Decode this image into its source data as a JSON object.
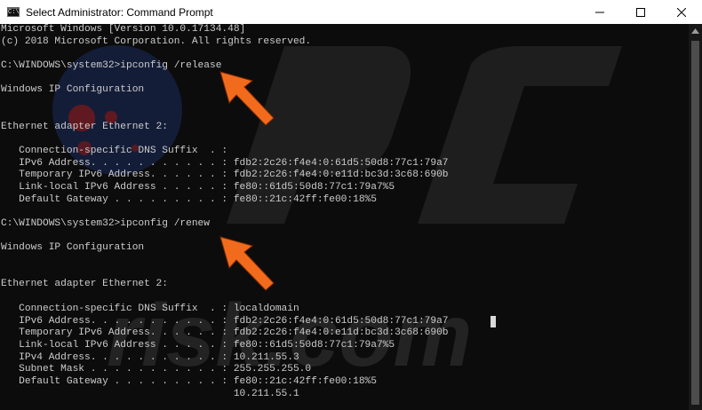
{
  "window": {
    "title": "Select Administrator: Command Prompt",
    "app_icon_text": "C:\\",
    "buttons": {
      "minimize_icon": "minimize-icon",
      "maximize_icon": "maximize-icon",
      "close_icon": "close-icon"
    }
  },
  "console": {
    "lines": [
      "Microsoft Windows [Version 10.0.17134.48]",
      "(c) 2018 Microsoft Corporation. All rights reserved.",
      "",
      "C:\\WINDOWS\\system32>ipconfig /release",
      "",
      "Windows IP Configuration",
      "",
      "",
      "Ethernet adapter Ethernet 2:",
      "",
      "   Connection-specific DNS Suffix  . :",
      "   IPv6 Address. . . . . . . . . . . : fdb2:2c26:f4e4:0:61d5:50d8:77c1:79a7",
      "   Temporary IPv6 Address. . . . . . : fdb2:2c26:f4e4:0:e11d:bc3d:3c68:690b",
      "   Link-local IPv6 Address . . . . . : fe80::61d5:50d8:77c1:79a7%5",
      "   Default Gateway . . . . . . . . . : fe80::21c:42ff:fe00:18%5",
      "",
      "C:\\WINDOWS\\system32>ipconfig /renew",
      "",
      "Windows IP Configuration",
      "",
      "",
      "Ethernet adapter Ethernet 2:",
      "",
      "   Connection-specific DNS Suffix  . : localdomain",
      "   IPv6 Address. . . . . . . . . . . : fdb2:2c26:f4e4:0:61d5:50d8:77c1:79a7",
      "   Temporary IPv6 Address. . . . . . : fdb2:2c26:f4e4:0:e11d:bc3d:3c68:690b",
      "   Link-local IPv6 Address . . . . . : fe80::61d5:50d8:77c1:79a7%5",
      "   IPv4 Address. . . . . . . . . . . : 10.211.55.3",
      "   Subnet Mask . . . . . . . . . . . : 255.255.255.0",
      "   Default Gateway . . . . . . . . . : fe80::21c:42ff:fe00:18%5",
      "                                       10.211.55.1"
    ],
    "text_color": "#cccccc",
    "background_color": "#0c0c0c"
  },
  "annotations": {
    "arrow_color": "#f26b1d",
    "arrow_icon": "orange-arrow-icon"
  },
  "watermark": {
    "text": "risk.com",
    "logo_icon": "pcrisk-logo-icon"
  },
  "scrollbar": {
    "up_icon": "scroll-up-arrow-icon"
  }
}
